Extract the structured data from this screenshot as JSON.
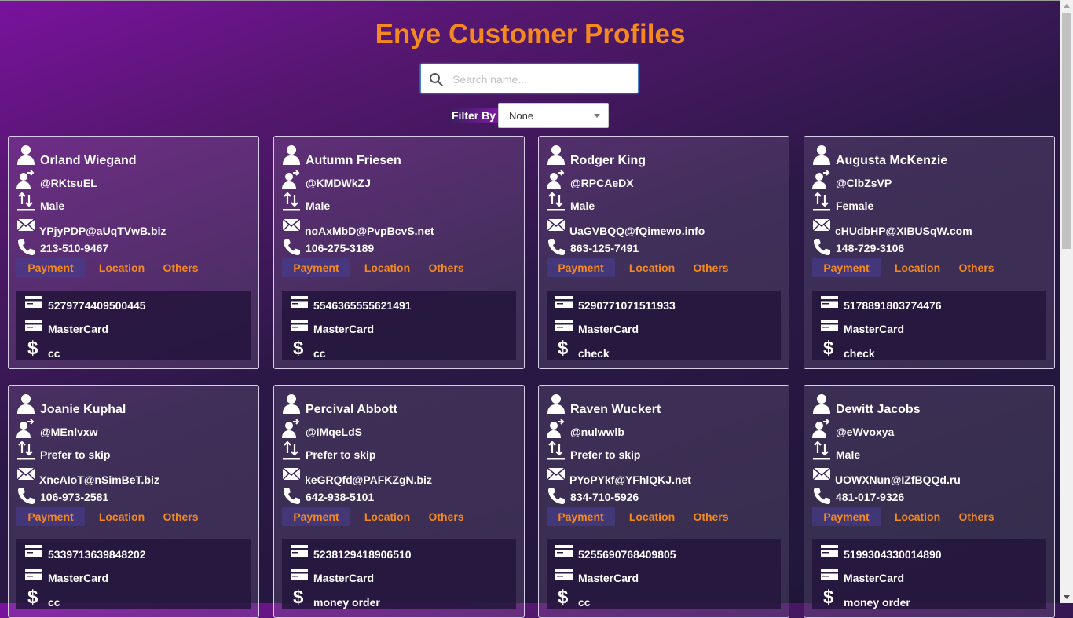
{
  "title": "Enye Customer Profiles",
  "search": {
    "placeholder": "Search name..."
  },
  "filter": {
    "label": "Filter By",
    "selected": "None"
  },
  "tab_labels": [
    "Payment",
    "Location",
    "Others"
  ],
  "colors": {
    "accent": "#f4891f",
    "background_start": "#7a129e",
    "background_end": "#1e1637"
  },
  "icons": {
    "name": "user-icon",
    "username": "user-share-icon",
    "gender": "sort-arrows-icon",
    "email": "envelope-icon",
    "phone": "phone-icon",
    "card_number": "credit-card-icon",
    "card_type": "credit-card-icon",
    "payment_method": "dollar-icon"
  },
  "profiles": [
    {
      "name": "Orland Wiegand",
      "username": "@RKtsuEL",
      "gender": "Male",
      "email": "YPjyPDP@aUqTVwB.biz",
      "phone": "213-510-9467",
      "card_number": "5279774409500445",
      "card_type": "MasterCard",
      "payment_method": "cc"
    },
    {
      "name": "Autumn Friesen",
      "username": "@KMDWkZJ",
      "gender": "Male",
      "email": "noAxMbD@PvpBcvS.net",
      "phone": "106-275-3189",
      "card_number": "5546365555621491",
      "card_type": "MasterCard",
      "payment_method": "cc"
    },
    {
      "name": "Rodger King",
      "username": "@RPCAeDX",
      "gender": "Male",
      "email": "UaGVBQQ@fQimewo.info",
      "phone": "863-125-7491",
      "card_number": "5290771071511933",
      "card_type": "MasterCard",
      "payment_method": "check"
    },
    {
      "name": "Augusta McKenzie",
      "username": "@ClbZsVP",
      "gender": "Female",
      "email": "cHUdbHP@XIBUSqW.com",
      "phone": "148-729-3106",
      "card_number": "5178891803774476",
      "card_type": "MasterCard",
      "payment_method": "check"
    },
    {
      "name": "Joanie Kuphal",
      "username": "@MEnlvxw",
      "gender": "Prefer to skip",
      "email": "XncAIoT@nSimBeT.biz",
      "phone": "106-973-2581",
      "card_number": "5339713639848202",
      "card_type": "MasterCard",
      "payment_method": "cc"
    },
    {
      "name": "Percival Abbott",
      "username": "@IMqeLdS",
      "gender": "Prefer to skip",
      "email": "keGRQfd@PAFKZgN.biz",
      "phone": "642-938-5101",
      "card_number": "5238129418906510",
      "card_type": "MasterCard",
      "payment_method": "money order"
    },
    {
      "name": "Raven Wuckert",
      "username": "@nulwwlb",
      "gender": "Prefer to skip",
      "email": "PYoPYkf@YFhlQKJ.net",
      "phone": "834-710-5926",
      "card_number": "5255690768409805",
      "card_type": "MasterCard",
      "payment_method": "cc"
    },
    {
      "name": "Dewitt Jacobs",
      "username": "@eWvoxya",
      "gender": "Male",
      "email": "UOWXNun@IZfBQQd.ru",
      "phone": "481-017-9326",
      "card_number": "5199304330014890",
      "card_type": "MasterCard",
      "payment_method": "money order"
    }
  ]
}
